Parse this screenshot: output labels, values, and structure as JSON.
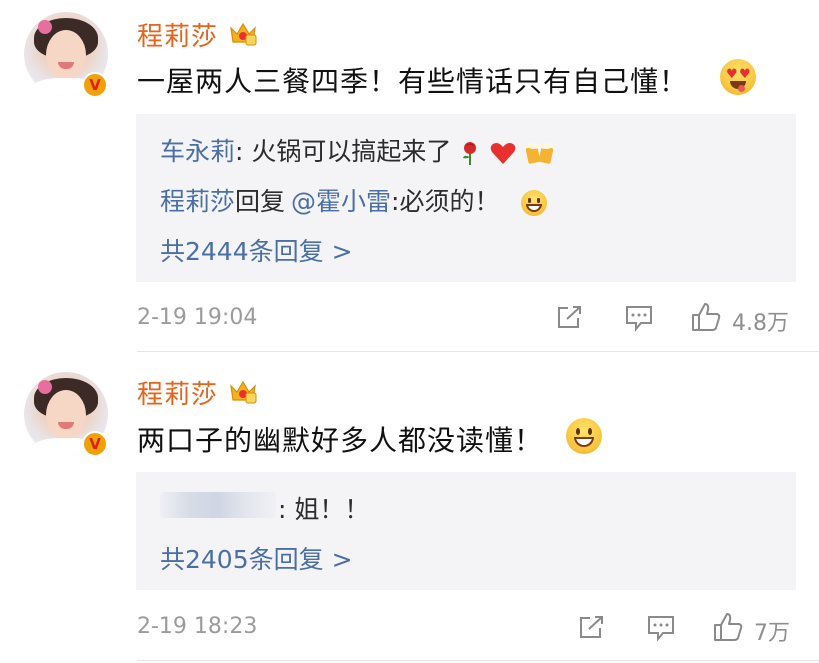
{
  "comments": [
    {
      "username": "程莉莎",
      "text": "一屋两人三餐四季！有些情话只有自己懂！",
      "verified_badge": "V",
      "emoji": "heart-eyes-tongue",
      "replies": [
        {
          "name": "车永莉",
          "sep": ": ",
          "text": "火锅可以搞起来了",
          "emojis": [
            "rose",
            "heart",
            "beer-cheers"
          ]
        },
        {
          "name": "程莉莎",
          "mid": "回复",
          "mention": "@霍小雷",
          "sep": ":",
          "text": "必须的！",
          "emojis": [
            "grin"
          ]
        }
      ],
      "more_replies": "共2444条回复 >",
      "time": "2-19 19:04",
      "like_count": "4.8万"
    },
    {
      "username": "程莉莎",
      "text": "两口子的幽默好多人都没读懂！",
      "verified_badge": "V",
      "emoji": "grin",
      "replies": [
        {
          "name": "",
          "sep": ": ",
          "text": "姐！！",
          "blurred_name": true
        }
      ],
      "more_replies": "共2405条回复 >",
      "time": "2-19 18:23",
      "like_count": "7万"
    }
  ],
  "colors": {
    "username": "#e8621a",
    "link": "#4a6fa5",
    "reply_bg": "#f4f4f6",
    "meta": "#9b9b9b"
  },
  "icons": [
    "crown-icon",
    "verified-badge-icon",
    "share-icon",
    "comment-icon",
    "like-icon"
  ]
}
